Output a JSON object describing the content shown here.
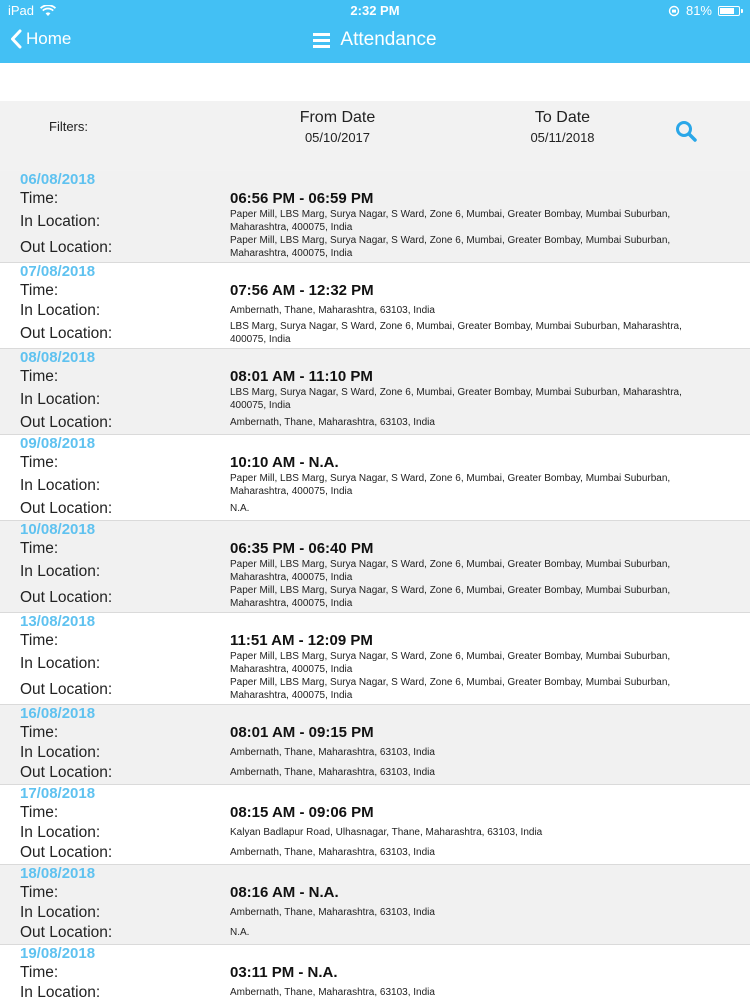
{
  "status_bar": {
    "device": "iPad",
    "time": "2:32 PM",
    "battery": "81%",
    "battery_level": 0.81
  },
  "nav": {
    "back_label": "Home",
    "title": "Attendance"
  },
  "filters": {
    "label": "Filters:",
    "from_label": "From Date",
    "from_value": "05/10/2017",
    "to_label": "To Date",
    "to_value": "05/11/2018"
  },
  "labels": {
    "time": "Time:",
    "in_location": "In Location:",
    "out_location": "Out Location:"
  },
  "records": [
    {
      "date": "06/08/2018",
      "time": "06:56 PM - 06:59 PM",
      "in_location": "Paper Mill, LBS Marg, Surya Nagar, S Ward, Zone 6, Mumbai, Greater Bombay, Mumbai Suburban, Maharashtra, 400075, India",
      "out_location": "Paper Mill, LBS Marg, Surya Nagar, S Ward, Zone 6, Mumbai, Greater Bombay, Mumbai Suburban, Maharashtra, 400075, India"
    },
    {
      "date": "07/08/2018",
      "time": "07:56 AM - 12:32 PM",
      "in_location": "Ambernath, Thane, Maharashtra, 63103, India",
      "out_location": "LBS Marg, Surya Nagar, S Ward, Zone 6, Mumbai, Greater Bombay, Mumbai Suburban, Maharashtra, 400075, India"
    },
    {
      "date": "08/08/2018",
      "time": "08:01 AM - 11:10 PM",
      "in_location": "LBS Marg, Surya Nagar, S Ward, Zone 6, Mumbai, Greater Bombay, Mumbai Suburban, Maharashtra, 400075, India",
      "out_location": "Ambernath, Thane, Maharashtra, 63103, India"
    },
    {
      "date": "09/08/2018",
      "time": "10:10 AM - N.A.",
      "in_location": "Paper Mill, LBS Marg, Surya Nagar, S Ward, Zone 6, Mumbai, Greater Bombay, Mumbai Suburban, Maharashtra, 400075, India",
      "out_location": "N.A."
    },
    {
      "date": "10/08/2018",
      "time": "06:35 PM - 06:40 PM",
      "in_location": "Paper Mill, LBS Marg, Surya Nagar, S Ward, Zone 6, Mumbai, Greater Bombay, Mumbai Suburban, Maharashtra, 400075, India",
      "out_location": "Paper Mill, LBS Marg, Surya Nagar, S Ward, Zone 6, Mumbai, Greater Bombay, Mumbai Suburban, Maharashtra, 400075, India"
    },
    {
      "date": "13/08/2018",
      "time": "11:51 AM - 12:09 PM",
      "in_location": "Paper Mill, LBS Marg, Surya Nagar, S Ward, Zone 6, Mumbai, Greater Bombay, Mumbai Suburban, Maharashtra, 400075, India",
      "out_location": "Paper Mill, LBS Marg, Surya Nagar, S Ward, Zone 6, Mumbai, Greater Bombay, Mumbai Suburban, Maharashtra, 400075, India"
    },
    {
      "date": "16/08/2018",
      "time": "08:01 AM - 09:15 PM",
      "in_location": "Ambernath, Thane, Maharashtra, 63103, India",
      "out_location": "Ambernath, Thane, Maharashtra, 63103, India"
    },
    {
      "date": "17/08/2018",
      "time": "08:15 AM - 09:06 PM",
      "in_location": "Kalyan Badlapur Road, Ulhasnagar, Thane, Maharashtra, 63103, India",
      "out_location": "Ambernath, Thane, Maharashtra, 63103, India"
    },
    {
      "date": "18/08/2018",
      "time": "08:16 AM - N.A.",
      "in_location": "Ambernath, Thane, Maharashtra, 63103, India",
      "out_location": "N.A."
    },
    {
      "date": "19/08/2018",
      "time": "03:11 PM - N.A.",
      "in_location": "Ambernath, Thane, Maharashtra, 63103, India",
      "out_location": ""
    }
  ],
  "colors": {
    "accent": "#43c0f4",
    "date_text": "#5fc2f0",
    "search_icon": "#2aa7e8"
  },
  "icons": {
    "back": "chevron-left-icon",
    "menu": "hamburger-menu-icon",
    "search": "search-icon",
    "wifi": "wifi-icon",
    "battery": "battery-icon"
  }
}
